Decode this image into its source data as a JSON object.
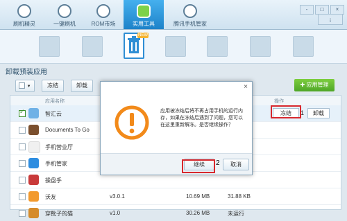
{
  "nav": {
    "items": [
      {
        "label": "刷机精灵"
      },
      {
        "label": "一键刷机"
      },
      {
        "label": "ROM市场"
      },
      {
        "label": "实用工具"
      },
      {
        "label": "腾讯手机管家"
      }
    ],
    "window_buttons": [
      "-",
      "□",
      "×"
    ],
    "back_arrow": "↓"
  },
  "subtoolbar": {
    "new_badge": "NEW"
  },
  "section_title": "卸载预装应用",
  "actionbar": {
    "freeze": "冻结",
    "uninstall": "卸载",
    "app_manage": "应用管理"
  },
  "list": {
    "headers": {
      "name": "应用名称",
      "op": "操作"
    },
    "rows": [
      {
        "name": "智汇云",
        "version": "",
        "size": "",
        "memory": ""
      },
      {
        "name": "Documents To Go",
        "version": "",
        "size": "",
        "memory": ""
      },
      {
        "name": "手机营业厅",
        "version": "",
        "size": "",
        "memory": ""
      },
      {
        "name": "手机管家",
        "version": "",
        "size": "",
        "memory": ""
      },
      {
        "name": "操盘手",
        "version": "",
        "size": "",
        "memory": ""
      },
      {
        "name": "沃友",
        "version": "v3.0.1",
        "size": "10.69 MB",
        "memory": "31.88 KB"
      },
      {
        "name": "穿靴子的猫",
        "version": "v1.0",
        "size": "30.26 MB",
        "memory": "未运行"
      }
    ],
    "row0_actions": {
      "freeze": "冻结",
      "uninstall": "卸载",
      "step": "1"
    }
  },
  "dialog": {
    "message": "应用被冻结后将不再占用手机的运行内存，如果在冻结后遇到了问题，您可以在这里重新解冻。是否继续操作？",
    "confirm": "继续",
    "cancel": "取消",
    "step": "2",
    "close": "×"
  },
  "colors": {
    "accent": "#1d82c9",
    "green": "#4ea627",
    "warn": "#f28a1a",
    "highlight": "#d8282d"
  }
}
